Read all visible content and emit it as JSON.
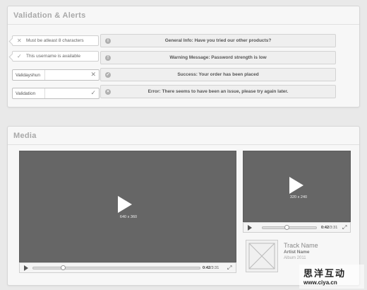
{
  "validation": {
    "title": "Validation & Alerts",
    "tooltips": [
      {
        "text": "Must be atleast 8 characters",
        "icon": "x-icon"
      },
      {
        "text": "This username is available",
        "icon": "check-icon"
      }
    ],
    "inputs": [
      {
        "value": "Validayshun",
        "icon": "clear-icon"
      },
      {
        "value": "Validation",
        "icon": "check-icon"
      }
    ],
    "alerts": [
      {
        "text": "General Info: Have you tried our other products?",
        "bullet": "i"
      },
      {
        "text": "Warning Message: Password strength is low",
        "bullet": "!"
      },
      {
        "text": "Success: Your order has been placed",
        "bullet": "✓"
      },
      {
        "text": "Error: There seems to have been an issue, please try again later.",
        "bullet": "×"
      }
    ]
  },
  "media": {
    "title": "Media",
    "large_video": {
      "size": "640 x 360",
      "time": "0:42",
      "duration": "/3:31",
      "progress": 0.18
    },
    "small_video": {
      "size": "320 x 240",
      "time": "0:42",
      "duration": "/3:31",
      "progress": 0.45
    },
    "audio": {
      "track": "Track Name",
      "artist": "Artist Name",
      "album": "Album 2011"
    }
  },
  "watermark": {
    "text": "思洋互动",
    "url": "www.ciya.cn"
  }
}
